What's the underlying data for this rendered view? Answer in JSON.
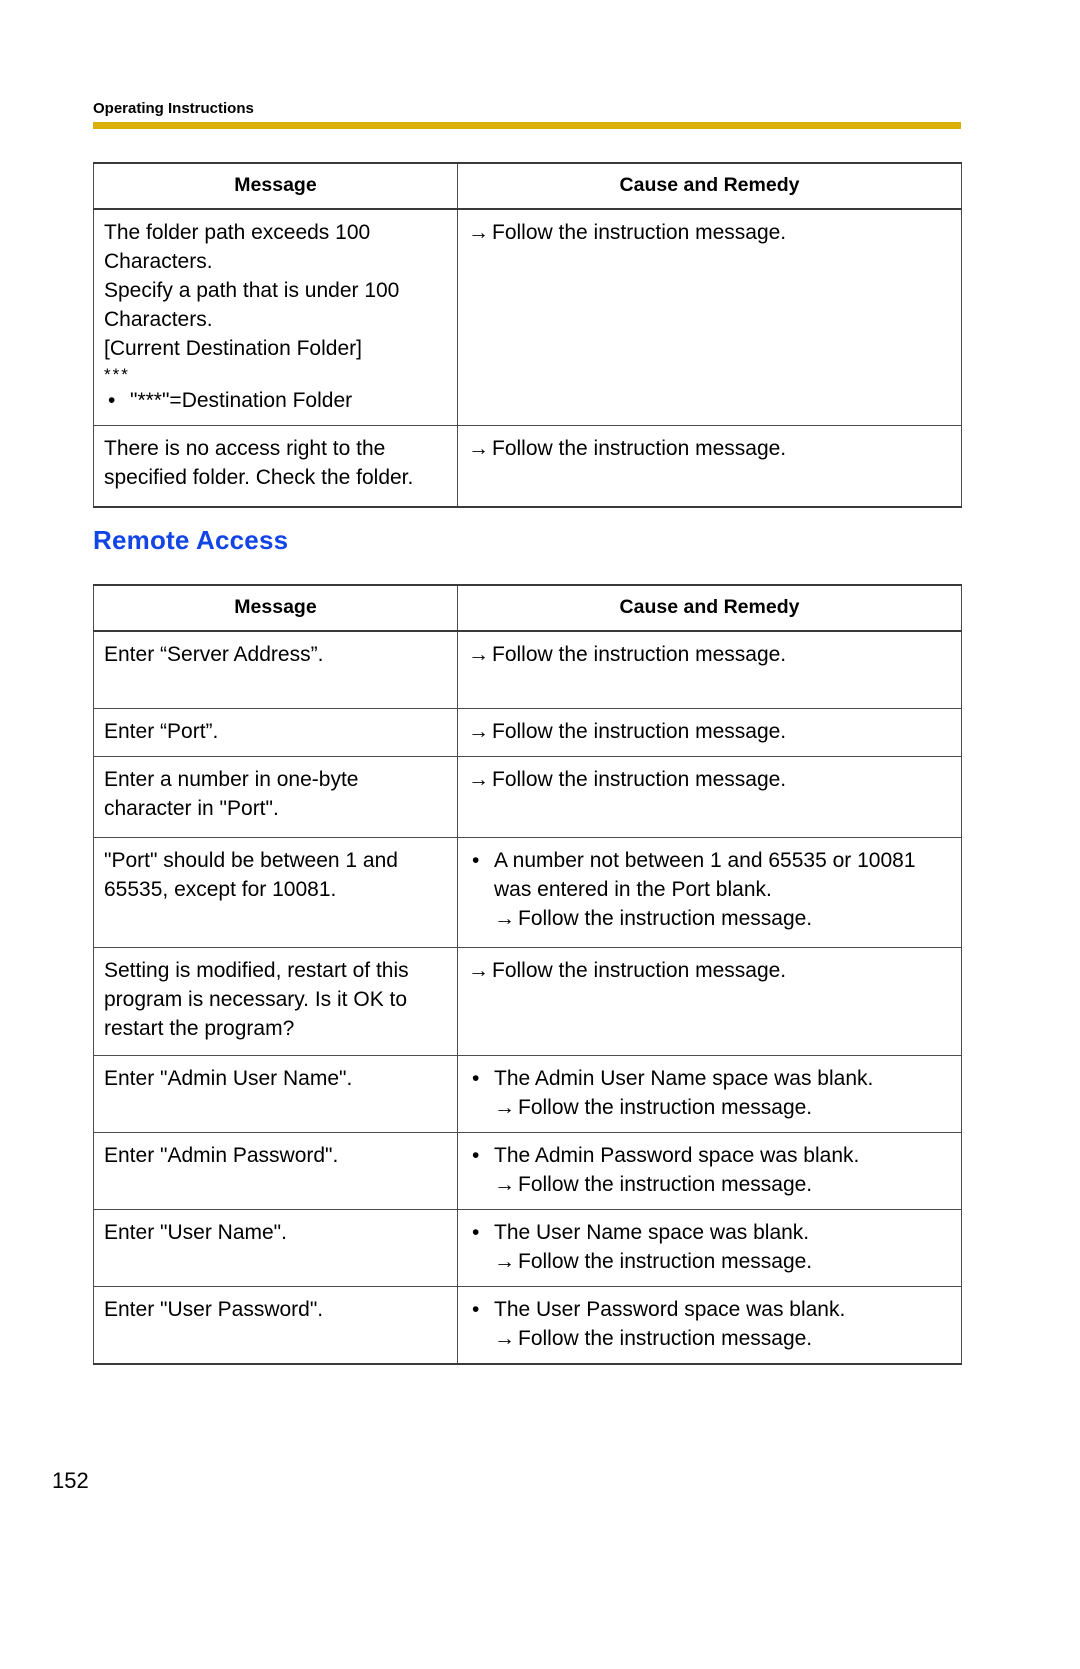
{
  "page": {
    "running_header": "Operating Instructions",
    "page_number": "152",
    "rule_color": "#d9b109",
    "heading_color": "#1344e6"
  },
  "arrow_glyph": "→",
  "bullet_glyph": "•",
  "tables": [
    {
      "id": "file-transfer-messages",
      "headers": {
        "message": "Message",
        "cause": "Cause and Remedy"
      },
      "rows": [
        {
          "message_lines": [
            "The folder path exceeds 100 Characters.",
            "Specify a path that is under 100 Characters.",
            "[Current Destination Folder]"
          ],
          "message_small_line": "***",
          "message_bullets": [
            "\"***\"=Destination Folder"
          ],
          "cause_arrow_lines": [
            "Follow the instruction message."
          ],
          "cause_bullets": []
        },
        {
          "message_lines": [
            "There is no access right to the specified folder. Check the folder."
          ],
          "message_small_line": "",
          "message_bullets": [],
          "cause_arrow_lines": [
            "Follow the instruction message."
          ],
          "cause_bullets": []
        }
      ]
    },
    {
      "id": "remote-access-messages",
      "headers": {
        "message": "Message",
        "cause": "Cause and Remedy"
      },
      "rows": [
        {
          "message_lines": [
            "Enter “Server Address”."
          ],
          "message_small_line": "",
          "message_bullets": [],
          "cause_arrow_lines": [
            "Follow the instruction message."
          ],
          "cause_bullets": []
        },
        {
          "message_lines": [
            "Enter “Port”."
          ],
          "message_small_line": "",
          "message_bullets": [],
          "cause_arrow_lines": [
            "Follow the instruction message."
          ],
          "cause_bullets": []
        },
        {
          "message_lines": [
            "Enter a number in one-byte character in \"Port\"."
          ],
          "message_small_line": "",
          "message_bullets": [],
          "cause_arrow_lines": [
            "Follow the instruction message."
          ],
          "cause_bullets": []
        },
        {
          "message_lines": [
            "\"Port\" should be between 1 and 65535, except for 10081."
          ],
          "message_small_line": "",
          "message_bullets": [],
          "cause_arrow_lines": [
            "Follow the instruction message."
          ],
          "cause_bullets": [
            "A number not between 1 and 65535 or 10081 was entered in the Port blank."
          ]
        },
        {
          "message_lines": [
            "Setting is modified, restart of this program is necessary. Is it OK to restart the program?"
          ],
          "message_small_line": "",
          "message_bullets": [],
          "cause_arrow_lines": [
            "Follow the instruction message."
          ],
          "cause_bullets": []
        },
        {
          "message_lines": [
            "Enter \"Admin User Name\"."
          ],
          "message_small_line": "",
          "message_bullets": [],
          "cause_arrow_lines": [
            "Follow the instruction message."
          ],
          "cause_bullets": [
            "The Admin User Name space was blank."
          ]
        },
        {
          "message_lines": [
            "Enter \"Admin Password\"."
          ],
          "message_small_line": "",
          "message_bullets": [],
          "cause_arrow_lines": [
            "Follow the instruction message."
          ],
          "cause_bullets": [
            "The Admin Password space was blank."
          ]
        },
        {
          "message_lines": [
            "Enter \"User Name\"."
          ],
          "message_small_line": "",
          "message_bullets": [],
          "cause_arrow_lines": [
            "Follow the instruction message."
          ],
          "cause_bullets": [
            "The User Name space was blank."
          ]
        },
        {
          "message_lines": [
            "Enter \"User Password\"."
          ],
          "message_small_line": "",
          "message_bullets": [],
          "cause_arrow_lines": [
            "Follow the instruction message."
          ],
          "cause_bullets": [
            "The User Password space was blank."
          ]
        }
      ]
    }
  ],
  "section_heading": "Remote Access"
}
